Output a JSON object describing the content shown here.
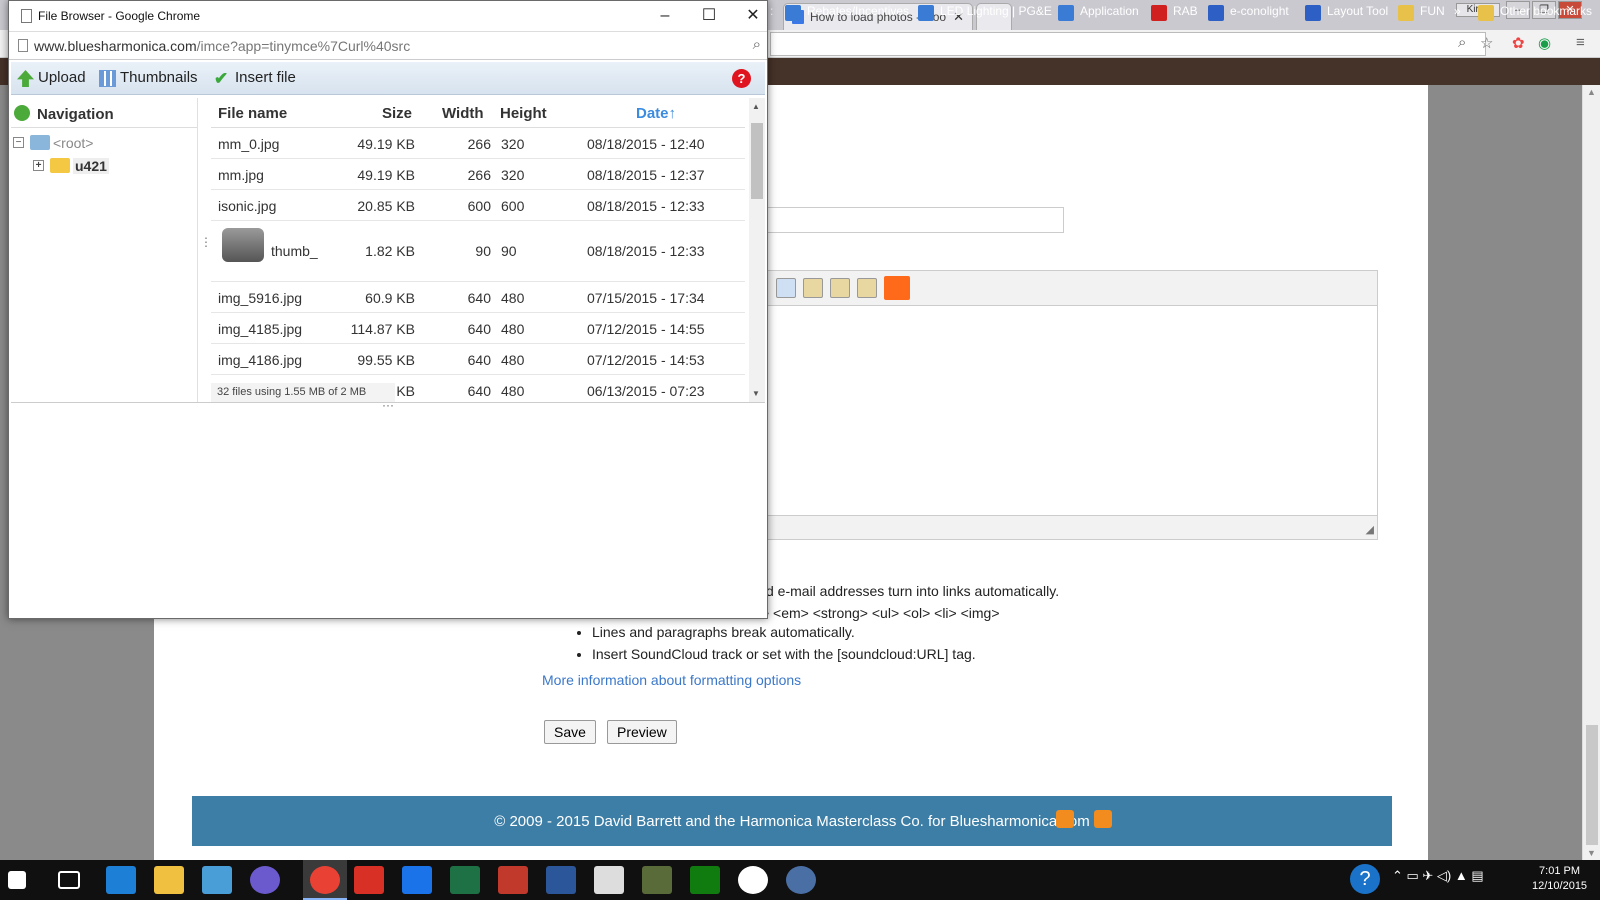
{
  "background_browser": {
    "tab_title": "How to load photos - Goo",
    "profile_name": "Kirya",
    "bookmarks": [
      "Rebates/Incentives",
      "LED Lighting | PG&E",
      "Application",
      "RAB",
      "e-conolight",
      "Layout Tool",
      "FUN",
      "Other bookmarks"
    ],
    "bookmark_overflow": "»"
  },
  "page": {
    "filter_tips": [
      "d e-mail addresses turn into links automatically.",
      "<a> <em> <strong> <ul> <ol> <li> <img>"
    ],
    "tips": [
      "Lines and paragraphs break automatically.",
      "Insert SoundCloud track or set with the [soundcloud:URL] tag."
    ],
    "more_link": "More information about formatting options",
    "save_label": "Save",
    "preview_label": "Preview",
    "footer_text": "© 2009 - 2015 David Barrett and the Harmonica Masterclass Co. for Bluesharmonica.com"
  },
  "popup": {
    "window_title": "File Browser - Google Chrome",
    "url_domain": "www.bluesharmonica.com",
    "url_path": "/imce?app=tinymce%7Curl%40src",
    "toolbar": {
      "upload": "Upload",
      "thumbnails": "Thumbnails",
      "insert": "Insert file",
      "help": "?"
    },
    "navigation": {
      "title": "Navigation",
      "root": "<root>",
      "folder": "u421"
    },
    "columns": {
      "name": "File name",
      "size": "Size",
      "width": "Width",
      "height": "Height",
      "date": "Date↑"
    },
    "files": [
      {
        "name": "mm_0.jpg",
        "size": "49.19 KB",
        "width": "266",
        "height": "320",
        "date": "08/18/2015 - 12:40"
      },
      {
        "name": "mm.jpg",
        "size": "49.19 KB",
        "width": "266",
        "height": "320",
        "date": "08/18/2015 - 12:37"
      },
      {
        "name": "isonic.jpg",
        "size": "20.85 KB",
        "width": "600",
        "height": "600",
        "date": "08/18/2015 - 12:33"
      },
      {
        "name": "thumb_",
        "size": "1.82 KB",
        "width": "90",
        "height": "90",
        "date": "08/18/2015 - 12:33"
      },
      {
        "name": "img_5916.jpg",
        "size": "60.9 KB",
        "width": "640",
        "height": "480",
        "date": "07/15/2015 - 17:34"
      },
      {
        "name": "img_4185.jpg",
        "size": "114.87 KB",
        "width": "640",
        "height": "480",
        "date": "07/12/2015 - 14:55"
      },
      {
        "name": "img_4186.jpg",
        "size": "99.55 KB",
        "width": "640",
        "height": "480",
        "date": "07/12/2015 - 14:53"
      },
      {
        "name": "",
        "size": "KB",
        "width": "640",
        "height": "480",
        "date": "06/13/2015 - 07:23"
      }
    ],
    "status": "32 files using 1.55 MB of 2 MB"
  },
  "taskbar": {
    "time": "7:01 PM",
    "date": "12/10/2015"
  },
  "colors": {
    "footer": "#3d7ea6",
    "link": "#3b78c9",
    "bookmarks_bar": "#453228",
    "toolbar": "#d7e3ef"
  }
}
